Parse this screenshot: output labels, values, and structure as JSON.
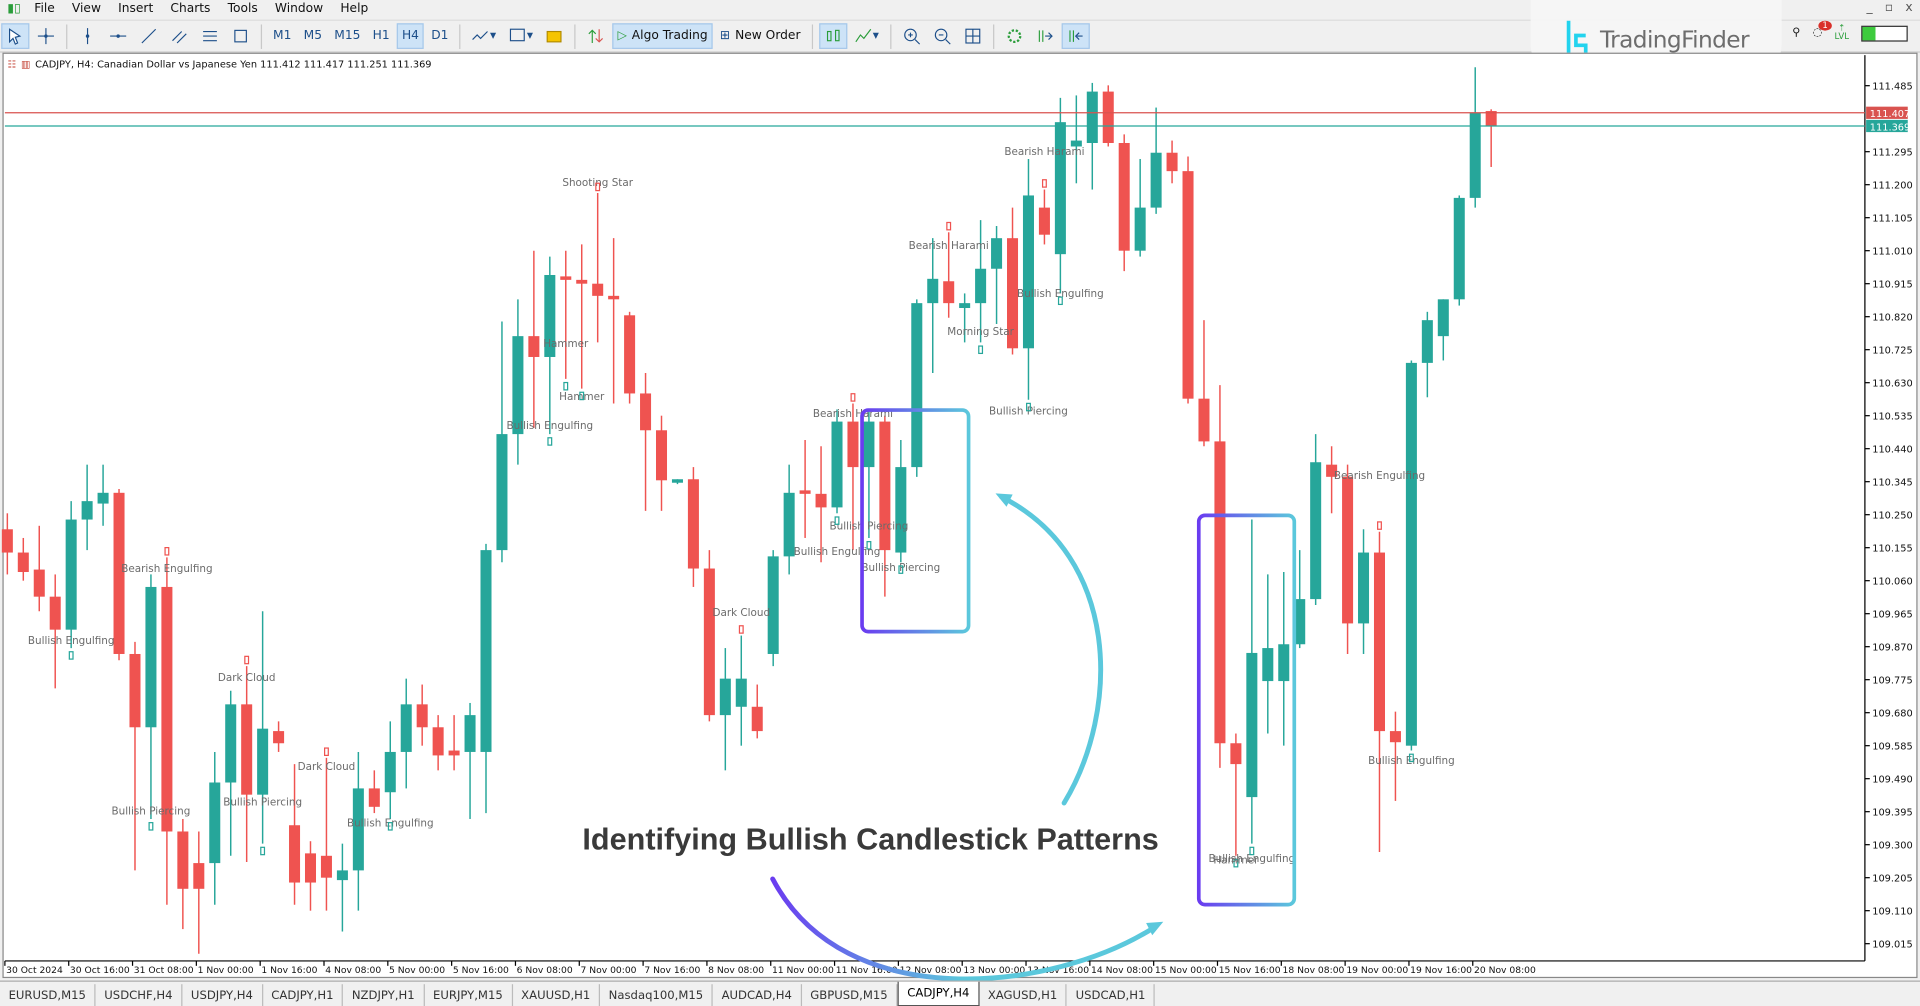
{
  "menu": {
    "items": [
      "File",
      "View",
      "Insert",
      "Charts",
      "Tools",
      "Window",
      "Help"
    ]
  },
  "toolbar": {
    "timeframes": [
      "M1",
      "M5",
      "M15",
      "H1",
      "H4",
      "D1"
    ],
    "active_timeframe": "H4",
    "algo_trading_label": "Algo Trading",
    "new_order_label": "New Order"
  },
  "branding": {
    "logo_text": "TradingFinder",
    "notification_count": "1",
    "lvl_label": "LVL"
  },
  "chart": {
    "header": "CADJPY, H4:  Canadian Dollar vs Japanese Yen  111.412 111.417 111.251 111.369",
    "symbol": "CADJPY",
    "timeframe": "H4",
    "colors": {
      "bull": "#26a69a",
      "bear": "#ef5350",
      "ask_line": "#d9534f",
      "bid_line": "#26a69a"
    },
    "ask_price": "111.407",
    "bid_price": "111.369",
    "price_ticks": [
      "111.485",
      "111.295",
      "111.200",
      "111.105",
      "111.010",
      "110.915",
      "110.820",
      "110.725",
      "110.630",
      "110.535",
      "110.440",
      "110.345",
      "110.250",
      "110.155",
      "110.060",
      "109.965",
      "109.870",
      "109.775",
      "109.680",
      "109.585",
      "109.490",
      "109.395",
      "109.300",
      "109.205",
      "109.110",
      "109.015"
    ],
    "time_labels": [
      "30 Oct 2024",
      "30 Oct 16:00",
      "31 Oct 08:00",
      "1 Nov 00:00",
      "1 Nov 16:00",
      "4 Nov 08:00",
      "5 Nov 00:00",
      "5 Nov 16:00",
      "6 Nov 08:00",
      "7 Nov 00:00",
      "7 Nov 16:00",
      "8 Nov 08:00",
      "11 Nov 00:00",
      "11 Nov 16:00",
      "12 Nov 08:00",
      "13 Nov 00:00",
      "13 Nov 16:00",
      "14 Nov 08:00",
      "15 Nov 00:00",
      "15 Nov 16:00",
      "18 Nov 08:00",
      "19 Nov 00:00",
      "19 Nov 16:00",
      "20 Nov 08:00"
    ]
  },
  "chart_data": {
    "type": "candlestick",
    "ylim": [
      108.98,
      111.56
    ],
    "time_label_every_n_candles": 4,
    "ohlc": [
      [
        110.208,
        110.254,
        110.078,
        110.141
      ],
      [
        110.141,
        110.183,
        110.06,
        110.085
      ],
      [
        110.092,
        110.218,
        109.972,
        110.014
      ],
      [
        110.014,
        110.078,
        109.75,
        109.919
      ],
      [
        109.919,
        110.289,
        109.866,
        110.236
      ],
      [
        110.236,
        110.394,
        110.148,
        110.289
      ],
      [
        110.282,
        110.394,
        110.218,
        110.313
      ],
      [
        110.313,
        110.324,
        109.831,
        109.849
      ],
      [
        109.849,
        109.884,
        109.226,
        109.638
      ],
      [
        109.638,
        110.078,
        109.374,
        110.042
      ],
      [
        110.042,
        110.127,
        109.127,
        109.338
      ],
      [
        109.338,
        109.374,
        109.057,
        109.173
      ],
      [
        109.247,
        109.338,
        108.986,
        109.173
      ],
      [
        109.247,
        109.567,
        109.127,
        109.479
      ],
      [
        109.479,
        109.743,
        109.268,
        109.704
      ],
      [
        109.704,
        109.814,
        109.25,
        109.444
      ],
      [
        109.444,
        109.972,
        109.303,
        109.634
      ],
      [
        109.627,
        109.655,
        109.567,
        109.592
      ],
      [
        109.356,
        109.532,
        109.127,
        109.191
      ],
      [
        109.275,
        109.31,
        109.11,
        109.191
      ],
      [
        109.268,
        109.55,
        109.11,
        109.205
      ],
      [
        109.198,
        109.303,
        109.05,
        109.226
      ],
      [
        109.226,
        109.567,
        109.11,
        109.462
      ],
      [
        109.462,
        109.514,
        109.391,
        109.409
      ],
      [
        109.451,
        109.655,
        109.374,
        109.567
      ],
      [
        109.567,
        109.778,
        109.462,
        109.704
      ],
      [
        109.704,
        109.761,
        109.585,
        109.638
      ],
      [
        109.638,
        109.673,
        109.514,
        109.557
      ],
      [
        109.571,
        109.673,
        109.514,
        109.557
      ],
      [
        109.567,
        109.708,
        109.374,
        109.673
      ],
      [
        109.567,
        110.166,
        109.391,
        110.148
      ],
      [
        110.148,
        110.806,
        110.113,
        110.482
      ],
      [
        110.482,
        110.87,
        110.394,
        110.764
      ],
      [
        110.764,
        111.01,
        110.5,
        110.704
      ],
      [
        110.704,
        110.993,
        110.482,
        110.94
      ],
      [
        110.936,
        111.01,
        110.641,
        110.926
      ],
      [
        110.926,
        111.028,
        110.613,
        110.915
      ],
      [
        110.915,
        111.176,
        110.746,
        110.88
      ],
      [
        110.88,
        111.046,
        110.57,
        110.87
      ],
      [
        110.824,
        110.834,
        110.57,
        110.599
      ],
      [
        110.599,
        110.658,
        110.261,
        110.493
      ],
      [
        110.493,
        110.535,
        110.261,
        110.349
      ],
      [
        110.342,
        110.352,
        110.338,
        110.352
      ],
      [
        110.352,
        110.387,
        110.042,
        110.095
      ],
      [
        110.095,
        110.148,
        109.655,
        109.673
      ],
      [
        109.673,
        109.866,
        109.514,
        109.778
      ],
      [
        109.697,
        109.902,
        109.585,
        109.778
      ],
      [
        109.697,
        109.761,
        109.606,
        109.627
      ],
      [
        109.849,
        110.148,
        109.814,
        110.13
      ],
      [
        110.13,
        110.394,
        110.078,
        110.313
      ],
      [
        110.32,
        110.465,
        110.183,
        110.31
      ],
      [
        110.31,
        110.447,
        110.113,
        110.271
      ],
      [
        110.271,
        110.553,
        110.254,
        110.518
      ],
      [
        110.518,
        110.57,
        110.148,
        110.387
      ],
      [
        110.387,
        110.553,
        110.183,
        110.518
      ],
      [
        110.518,
        110.535,
        110.014,
        110.148
      ],
      [
        110.141,
        110.465,
        110.113,
        110.387
      ],
      [
        110.387,
        110.87,
        110.359,
        110.859
      ],
      [
        110.859,
        111.046,
        110.658,
        110.929
      ],
      [
        110.922,
        111.063,
        110.817,
        110.859
      ],
      [
        110.845,
        110.887,
        110.746,
        110.859
      ],
      [
        110.859,
        111.098,
        110.746,
        110.958
      ],
      [
        110.958,
        111.081,
        110.799,
        111.046
      ],
      [
        111.046,
        111.134,
        110.711,
        110.729
      ],
      [
        110.729,
        111.274,
        110.581,
        111.169
      ],
      [
        111.134,
        111.186,
        111.028,
        111.056
      ],
      [
        111.0,
        111.45,
        110.887,
        111.38
      ],
      [
        111.31,
        111.457,
        111.204,
        111.327
      ],
      [
        111.32,
        111.493,
        111.186,
        111.468
      ],
      [
        111.468,
        111.486,
        111.31,
        111.32
      ],
      [
        111.32,
        111.345,
        110.951,
        111.01
      ],
      [
        111.01,
        111.274,
        110.993,
        111.134
      ],
      [
        111.134,
        111.422,
        111.116,
        111.292
      ],
      [
        111.292,
        111.327,
        111.204,
        111.239
      ],
      [
        111.239,
        111.281,
        110.57,
        110.584
      ],
      [
        110.584,
        110.81,
        110.447,
        110.461
      ],
      [
        110.461,
        110.623,
        109.521,
        109.592
      ],
      [
        109.592,
        109.62,
        109.268,
        109.532
      ],
      [
        109.437,
        110.236,
        109.303,
        109.852
      ],
      [
        109.771,
        110.078,
        109.62,
        109.866
      ],
      [
        109.771,
        110.085,
        109.585,
        109.877
      ],
      [
        109.877,
        110.148,
        109.866,
        110.007
      ],
      [
        110.007,
        110.482,
        109.99,
        110.401
      ],
      [
        110.394,
        110.447,
        110.254,
        110.359
      ],
      [
        110.359,
        110.394,
        109.849,
        109.937
      ],
      [
        109.937,
        110.208,
        109.849,
        110.141
      ],
      [
        110.141,
        110.201,
        109.279,
        109.627
      ],
      [
        109.627,
        109.683,
        109.426,
        109.595
      ],
      [
        109.585,
        110.694,
        109.571,
        110.687
      ],
      [
        110.687,
        110.834,
        110.588,
        110.81
      ],
      [
        110.764,
        110.87,
        110.694,
        110.87
      ],
      [
        110.87,
        111.169,
        110.852,
        111.162
      ],
      [
        111.162,
        111.538,
        111.134,
        111.408
      ],
      [
        111.412,
        111.417,
        111.251,
        111.369
      ]
    ],
    "patterns": [
      {
        "text": "Bearish Engulfing",
        "candle": 10,
        "price": 110.095,
        "type": "bearish"
      },
      {
        "text": "Bullish Engulfing",
        "candle": 4,
        "price": 109.888,
        "type": "bullish"
      },
      {
        "text": "Dark Cloud",
        "candle": 15,
        "price": 109.782,
        "type": "bearish"
      },
      {
        "text": "Bullish Piercing",
        "candle": 9,
        "price": 109.398,
        "type": "bullish"
      },
      {
        "text": "Bullish Piercing",
        "candle": 16,
        "price": 109.423,
        "type": "bullish"
      },
      {
        "text": "Dark Cloud",
        "candle": 20,
        "price": 109.525,
        "type": "bearish"
      },
      {
        "text": "Bullish Engulfing",
        "candle": 24,
        "price": 109.363,
        "type": "bullish"
      },
      {
        "text": "Shooting Star",
        "candle": 37,
        "price": 111.207,
        "type": "bearish"
      },
      {
        "text": "Hammer",
        "candle": 35,
        "price": 110.743,
        "type": "bullish"
      },
      {
        "text": "Hammer",
        "candle": 36,
        "price": 110.591,
        "type": "bullish"
      },
      {
        "text": "Bullish Engulfing",
        "candle": 34,
        "price": 110.507,
        "type": "bullish"
      },
      {
        "text": "Dark Cloud",
        "candle": 46,
        "price": 109.969,
        "type": "bearish"
      },
      {
        "text": "Bearish Harami",
        "candle": 53,
        "price": 110.542,
        "type": "bearish"
      },
      {
        "text": "Bullish Piercing",
        "candle": 54,
        "price": 110.218,
        "type": "bullish"
      },
      {
        "text": "Bullish Engulfing",
        "candle": 52,
        "price": 110.144,
        "type": "bullish"
      },
      {
        "text": "Bullish Piercing",
        "candle": 56,
        "price": 110.099,
        "type": "bullish"
      },
      {
        "text": "Bearish Harami",
        "candle": 59,
        "price": 111.025,
        "type": "bearish"
      },
      {
        "text": "Morning Star",
        "candle": 61,
        "price": 110.778,
        "type": "bullish"
      },
      {
        "text": "Bullish Piercing",
        "candle": 64,
        "price": 110.549,
        "type": "bullish"
      },
      {
        "text": "Bearish Harami",
        "candle": 65,
        "price": 111.296,
        "type": "bearish"
      },
      {
        "text": "Bullish Engulfing",
        "candle": 66,
        "price": 110.887,
        "type": "bullish"
      },
      {
        "text": "Hammer",
        "candle": 77,
        "price": 109.257,
        "type": "bullish"
      },
      {
        "text": "Bullish Engulfing",
        "candle": 78,
        "price": 109.261,
        "type": "bullish"
      },
      {
        "text": "Bearish Engulfing",
        "candle": 86,
        "price": 110.363,
        "type": "bearish"
      },
      {
        "text": "Bullish Engulfing",
        "candle": 88,
        "price": 109.543,
        "type": "bullish"
      }
    ]
  },
  "annotation": {
    "title": "Identifying Bullish Candlestick Patterns",
    "gradient": [
      "#6a3cf0",
      "#5bc8dc"
    ]
  },
  "tabs": [
    {
      "label": "EURUSD,M15"
    },
    {
      "label": "USDCHF,H4"
    },
    {
      "label": "USDJPY,H4"
    },
    {
      "label": "CADJPY,H1"
    },
    {
      "label": "NZDJPY,H1"
    },
    {
      "label": "EURJPY,M15"
    },
    {
      "label": "XAUUSD,H1"
    },
    {
      "label": "Nasdaq100,M15"
    },
    {
      "label": "AUDCAD,H4"
    },
    {
      "label": "GBPUSD,M15"
    },
    {
      "label": "CADJPY,H4",
      "active": true
    },
    {
      "label": "XAGUSD,H1"
    },
    {
      "label": "USDCAD,H1"
    }
  ]
}
